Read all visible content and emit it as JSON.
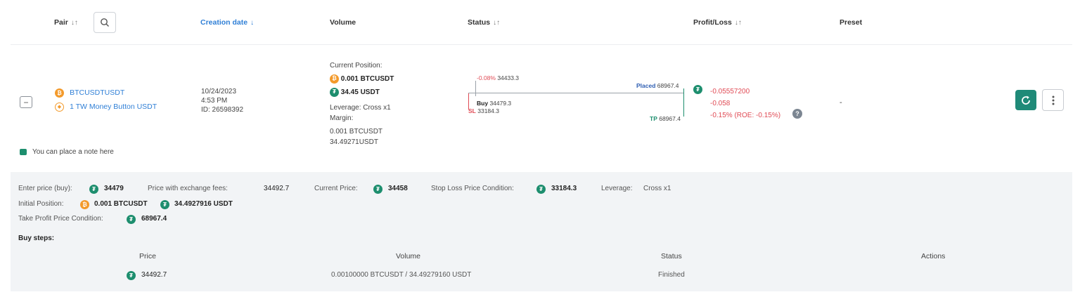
{
  "header": {
    "pair": "Pair",
    "creation_date": "Creation date",
    "volume": "Volume",
    "status": "Status",
    "profit_loss": "Profit/Loss",
    "preset": "Preset"
  },
  "row": {
    "pair_symbol": "BTCUSDTUSDT",
    "bot_name": "1 TW Money Button USDT",
    "date": "10/24/2023",
    "time": "4:53 PM",
    "id": "ID: 26598392",
    "current_position_label": "Current Position:",
    "position_btc": "0.001 BTCUSDT",
    "position_usdt": "34.45 USDT",
    "leverage": "Leverage: Cross x1",
    "margin_label": "Margin:",
    "margin_btc": "0.001 BTCUSDT",
    "margin_usdt": "34.49271USDT",
    "status_chart": {
      "sl_pct": "-0.08%",
      "sl_price_top": "34433.3",
      "placed_label": "Placed",
      "placed_value": "68967.4",
      "buy_label": "Buy",
      "buy_value": "34479.3",
      "sl_marker": "SL",
      "sl_value": "33184.3",
      "tp_label": "TP",
      "tp_value": "68967.4"
    },
    "pl_value": "-0.05557200",
    "pl_value2": "-0.058",
    "pl_pct": "-0.15% (ROE: -0.15%)",
    "preset_value": "-",
    "note_text": "You can place a note here"
  },
  "details": {
    "enter_price_label": "Enter price (buy):",
    "enter_price_value": "34479",
    "price_fees_label": "Price with exchange fees:",
    "price_fees_value": "34492.7",
    "current_price_label": "Current Price:",
    "current_price_value": "34458",
    "sl_condition_label": "Stop Loss Price Condition:",
    "sl_condition_value": "33184.3",
    "leverage_label": "Leverage:",
    "leverage_value": "Cross x1",
    "initial_position_label": "Initial Position:",
    "initial_btc": "0.001 BTCUSDT",
    "initial_usdt": "34.4927916 USDT",
    "tp_condition_label": "Take Profit Price Condition:",
    "tp_condition_value": "68967.4",
    "buy_steps_label": "Buy steps:",
    "steps_headers": {
      "price": "Price",
      "volume": "Volume",
      "status": "Status",
      "actions": "Actions"
    },
    "steps": [
      {
        "price": "34492.7",
        "volume": "0.00100000 BTCUSDT / 34.49279160 USDT",
        "status": "Finished"
      }
    ]
  },
  "colors": {
    "accent_blue": "#2f7fd6",
    "usdt_green": "#1d8e6e",
    "btc_orange": "#f39a2b",
    "loss_red": "#e04a54",
    "panel_bg": "#f2f4f6"
  },
  "icons": {
    "search": "search-icon",
    "refresh": "refresh-icon",
    "more": "more-vertical-icon",
    "note": "note-icon",
    "info": "info-icon"
  }
}
